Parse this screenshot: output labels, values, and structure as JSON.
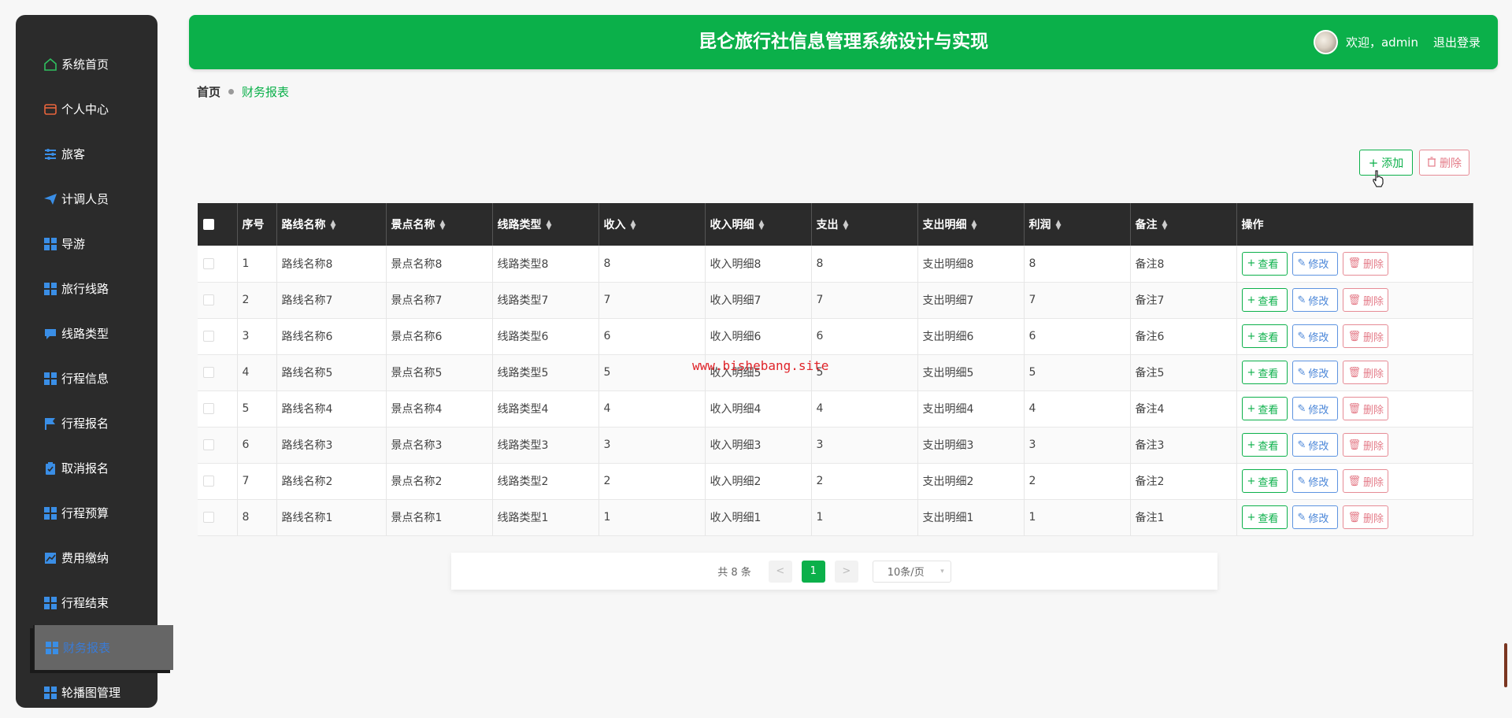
{
  "app": {
    "title": "昆仑旅行社信息管理系统设计与实现"
  },
  "user": {
    "greeting": "欢迎，admin",
    "logout": "退出登录"
  },
  "colors": {
    "primary": "#0bb04a",
    "sidebar": "#2b2b2b",
    "danger": "#e47b88",
    "info": "#4a86d8"
  },
  "sidebar": {
    "items": [
      {
        "label": "系统首页",
        "icon": "home-icon"
      },
      {
        "label": "个人中心",
        "icon": "wallet-icon"
      },
      {
        "label": "旅客",
        "icon": "sliders-icon"
      },
      {
        "label": "计调人员",
        "icon": "paper-plane-icon"
      },
      {
        "label": "导游",
        "icon": "grid-icon"
      },
      {
        "label": "旅行线路",
        "icon": "grid-icon"
      },
      {
        "label": "线路类型",
        "icon": "chat-icon"
      },
      {
        "label": "行程信息",
        "icon": "grid-icon"
      },
      {
        "label": "行程报名",
        "icon": "flag-icon"
      },
      {
        "label": "取消报名",
        "icon": "clipboard-check-icon"
      },
      {
        "label": "行程预算",
        "icon": "grid-icon"
      },
      {
        "label": "费用缴纳",
        "icon": "chart-icon"
      },
      {
        "label": "行程结束",
        "icon": "grid-icon"
      },
      {
        "label": "财务报表",
        "icon": "grid-icon",
        "active": true
      },
      {
        "label": "轮播图管理",
        "icon": "grid-icon"
      }
    ]
  },
  "breadcrumb": {
    "home": "首页",
    "current": "财务报表"
  },
  "toolbar": {
    "add": "添加",
    "delete": "删除"
  },
  "table": {
    "columns": [
      "序号",
      "路线名称",
      "景点名称",
      "线路类型",
      "收入",
      "收入明细",
      "支出",
      "支出明细",
      "利润",
      "备注",
      "操作"
    ],
    "rows": [
      [
        "1",
        "路线名称8",
        "景点名称8",
        "线路类型8",
        "8",
        "收入明细8",
        "8",
        "支出明细8",
        "8",
        "备注8"
      ],
      [
        "2",
        "路线名称7",
        "景点名称7",
        "线路类型7",
        "7",
        "收入明细7",
        "7",
        "支出明细7",
        "7",
        "备注7"
      ],
      [
        "3",
        "路线名称6",
        "景点名称6",
        "线路类型6",
        "6",
        "收入明细6",
        "6",
        "支出明细6",
        "6",
        "备注6"
      ],
      [
        "4",
        "路线名称5",
        "景点名称5",
        "线路类型5",
        "5",
        "收入明细5",
        "5",
        "支出明细5",
        "5",
        "备注5"
      ],
      [
        "5",
        "路线名称4",
        "景点名称4",
        "线路类型4",
        "4",
        "收入明细4",
        "4",
        "支出明细4",
        "4",
        "备注4"
      ],
      [
        "6",
        "路线名称3",
        "景点名称3",
        "线路类型3",
        "3",
        "收入明细3",
        "3",
        "支出明细3",
        "3",
        "备注3"
      ],
      [
        "7",
        "路线名称2",
        "景点名称2",
        "线路类型2",
        "2",
        "收入明细2",
        "2",
        "支出明细2",
        "2",
        "备注2"
      ],
      [
        "8",
        "路线名称1",
        "景点名称1",
        "线路类型1",
        "1",
        "收入明细1",
        "1",
        "支出明细1",
        "1",
        "备注1"
      ]
    ],
    "actions": {
      "view": "查看",
      "edit": "修改",
      "delete": "删除"
    }
  },
  "watermark": "www.bishebang.site",
  "pagination": {
    "total": "共 8 条",
    "prev": "<",
    "next": ">",
    "current": "1",
    "page_size": "10条/页"
  }
}
